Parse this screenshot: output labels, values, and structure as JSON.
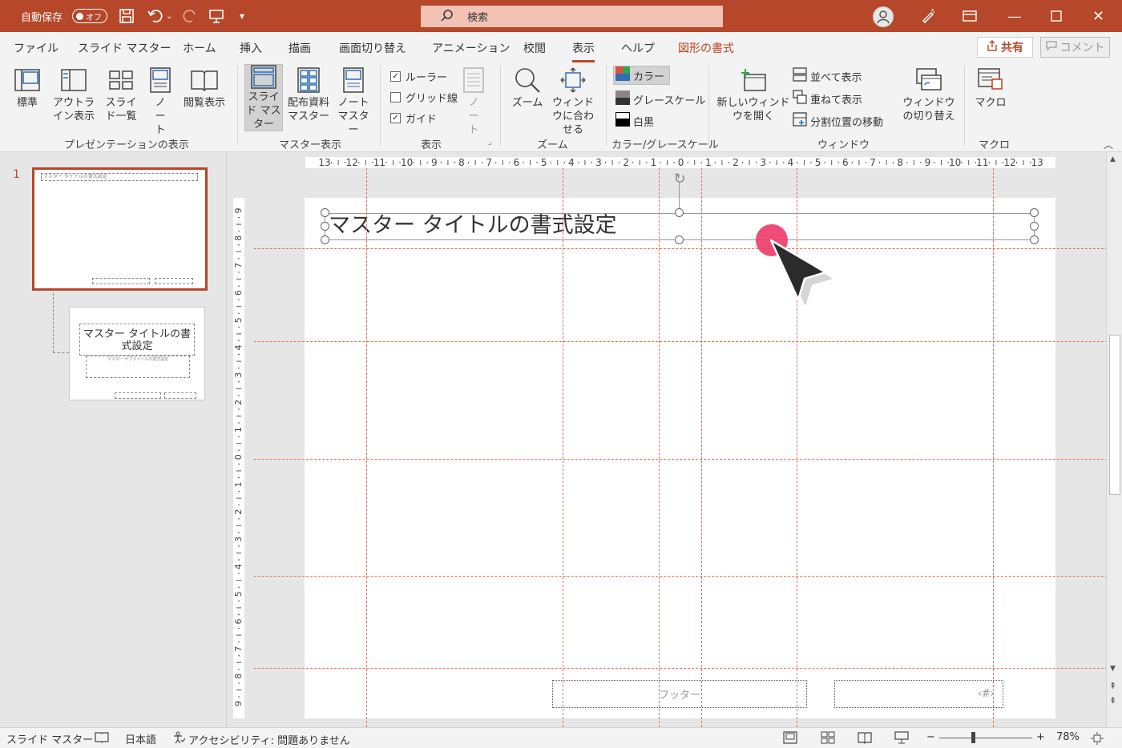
{
  "titlebar": {
    "autosave_label": "自動保存",
    "autosave_state": "オフ",
    "search_placeholder": "検索",
    "accent_color": "#b7472a"
  },
  "tabs": [
    "ファイル",
    "スライド マスター",
    "ホーム",
    "挿入",
    "描画",
    "画面切り替え",
    "アニメーション",
    "校閲",
    "表示",
    "ヘルプ",
    "図形の書式"
  ],
  "active_tab": "表示",
  "share_label": "共有",
  "comment_label": "コメント",
  "ribbon": {
    "presentation_views": {
      "label": "プレゼンテーションの表示",
      "buttons": [
        "標準",
        "アウトライン表示",
        "スライド一覧",
        "ノート",
        "閲覧表示"
      ]
    },
    "master_views": {
      "label": "マスター表示",
      "buttons": [
        "スライド マスター",
        "配布資料 マスター",
        "ノート マスター"
      ]
    },
    "show": {
      "label": "表示",
      "ruler": "ルーラー",
      "gridlines": "グリッド線",
      "guides": "ガイド",
      "notes": "ノート"
    },
    "zoom": {
      "label": "ズーム",
      "zoom": "ズーム",
      "fit": "ウィンドウに合わせる"
    },
    "color": {
      "label": "カラー/グレースケール",
      "color": "カラー",
      "grayscale": "グレースケール",
      "bw": "白黒"
    },
    "window": {
      "label": "ウィンドウ",
      "new_window": "新しいウィンドウを開く",
      "arrange_all": "並べて表示",
      "cascade": "重ねて表示",
      "move_split": "分割位置の移動",
      "switch_windows": "ウィンドウの切り替え"
    },
    "macros": {
      "label": "マクロ",
      "macros": "マクロ"
    }
  },
  "thumbnails": {
    "slide_number": "1",
    "master_title_tiny": "マスター タイトルの書式設定",
    "layout_title": "マスター タイトルの書式設定",
    "layout_subtitle": "マスター サブタイトルの書式設定"
  },
  "slide": {
    "title": "マスター タイトルの書式設定",
    "footer": "フッター",
    "page_number": "‹#›"
  },
  "ruler": {
    "horizontal": [
      "13",
      "12",
      "11",
      "10",
      "9",
      "8",
      "7",
      "6",
      "5",
      "4",
      "3",
      "2",
      "1",
      "0",
      "1",
      "2",
      "3",
      "4",
      "5",
      "6",
      "7",
      "8",
      "9",
      "10",
      "11",
      "12",
      "13"
    ],
    "vertical": [
      "9",
      "8",
      "7",
      "6",
      "5",
      "4",
      "3",
      "2",
      "1",
      "0",
      "1",
      "2",
      "3",
      "4",
      "5",
      "6",
      "7",
      "8",
      "9"
    ]
  },
  "statusbar": {
    "view_name": "スライド マスター",
    "language": "日本語",
    "accessibility": "アクセシビリティ: 問題ありません",
    "zoom": "78%"
  }
}
